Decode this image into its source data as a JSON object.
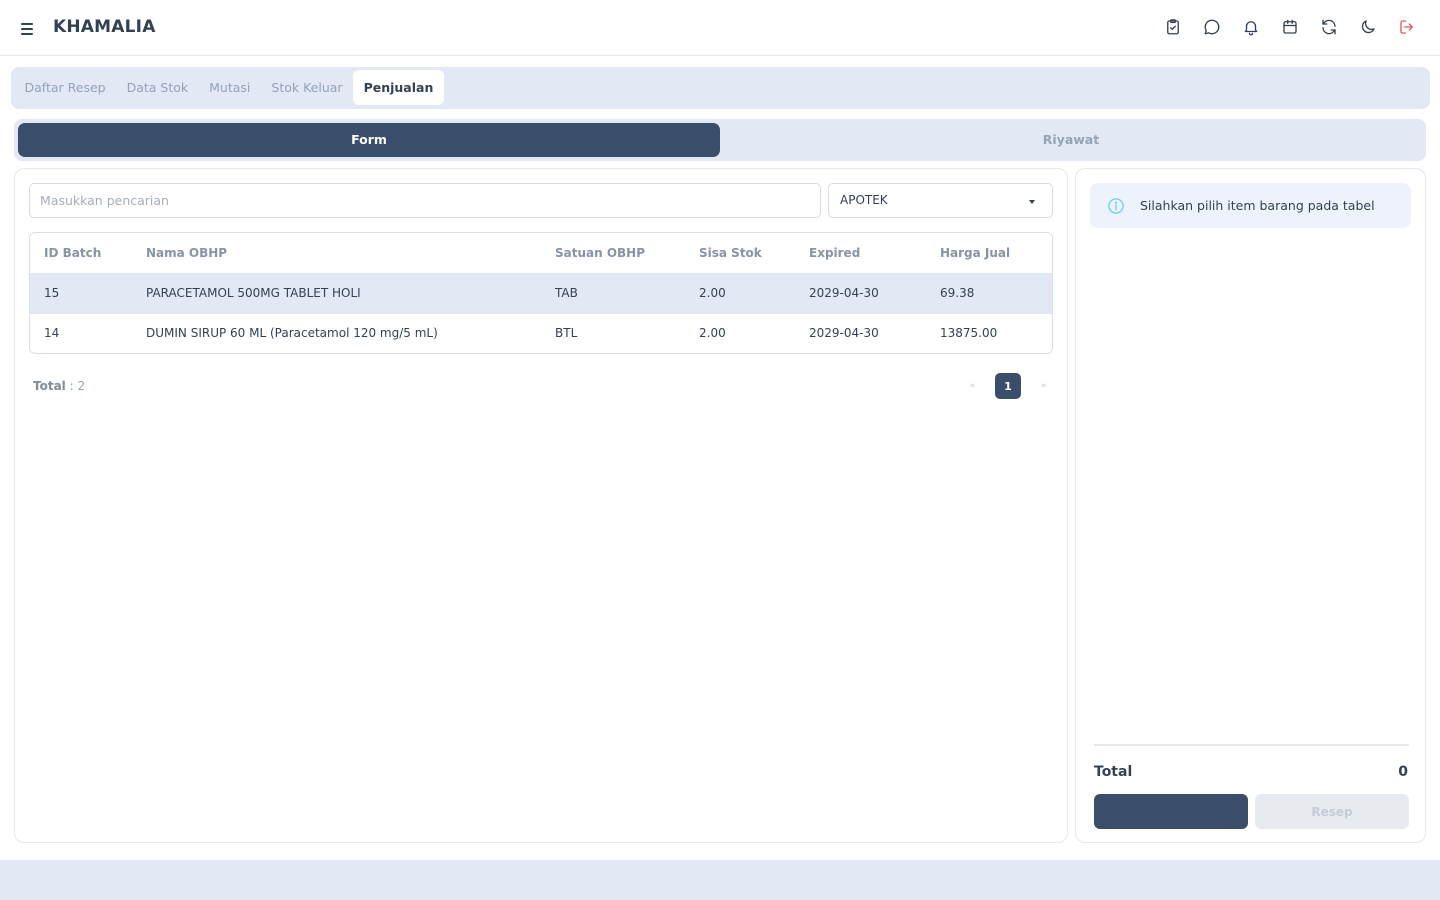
{
  "app": {
    "title": "KHAMALIA",
    "header_icons": [
      "clipboard-check-icon",
      "chat-icon",
      "bell-icon",
      "calendar-icon",
      "refresh-icon",
      "moon-icon",
      "logout-icon"
    ]
  },
  "nav": {
    "tabs": [
      {
        "label": "Daftar Resep",
        "active": false
      },
      {
        "label": "Data Stok",
        "active": false
      },
      {
        "label": "Mutasi",
        "active": false
      },
      {
        "label": "Stok Keluar",
        "active": false
      },
      {
        "label": "Penjualan",
        "active": true
      }
    ]
  },
  "switch": {
    "form_label": "Form",
    "history_label": "Riyawat",
    "active": "Form"
  },
  "search": {
    "placeholder": "Masukkan pencarian",
    "value": ""
  },
  "location_select": {
    "value": "APOTEK"
  },
  "table": {
    "columns": [
      "ID Batch",
      "Nama OBHP",
      "Satuan OBHP",
      "Sisa Stok",
      "Expired",
      "Harga Jual"
    ],
    "rows": [
      {
        "id": "15",
        "name": "PARACETAMOL 500MG TABLET HOLI",
        "unit": "TAB",
        "stock": "2.00",
        "expired": "2029-04-30",
        "price": "69.38",
        "selected": true
      },
      {
        "id": "14",
        "name": "DUMIN SIRUP 60 ML (Paracetamol 120 mg/5 mL)",
        "unit": "BTL",
        "stock": "2.00",
        "expired": "2029-04-30",
        "price": "13875.00",
        "selected": false
      }
    ]
  },
  "footer": {
    "total_label": "Total",
    "total_value": ": 2",
    "pagination": {
      "prev": "«",
      "current": "1",
      "next": "»"
    }
  },
  "cart": {
    "info_text": "Silahkan pilih item barang pada tabel",
    "total_label": "Total",
    "total_value": "0",
    "primary_button_label": "",
    "resep_button_label": "Resep"
  },
  "colors": {
    "primary": "#3a4e6b",
    "surface_muted": "#e2e8f4",
    "logout_red": "#e05a5a",
    "info_cyan": "#67d1e8"
  }
}
